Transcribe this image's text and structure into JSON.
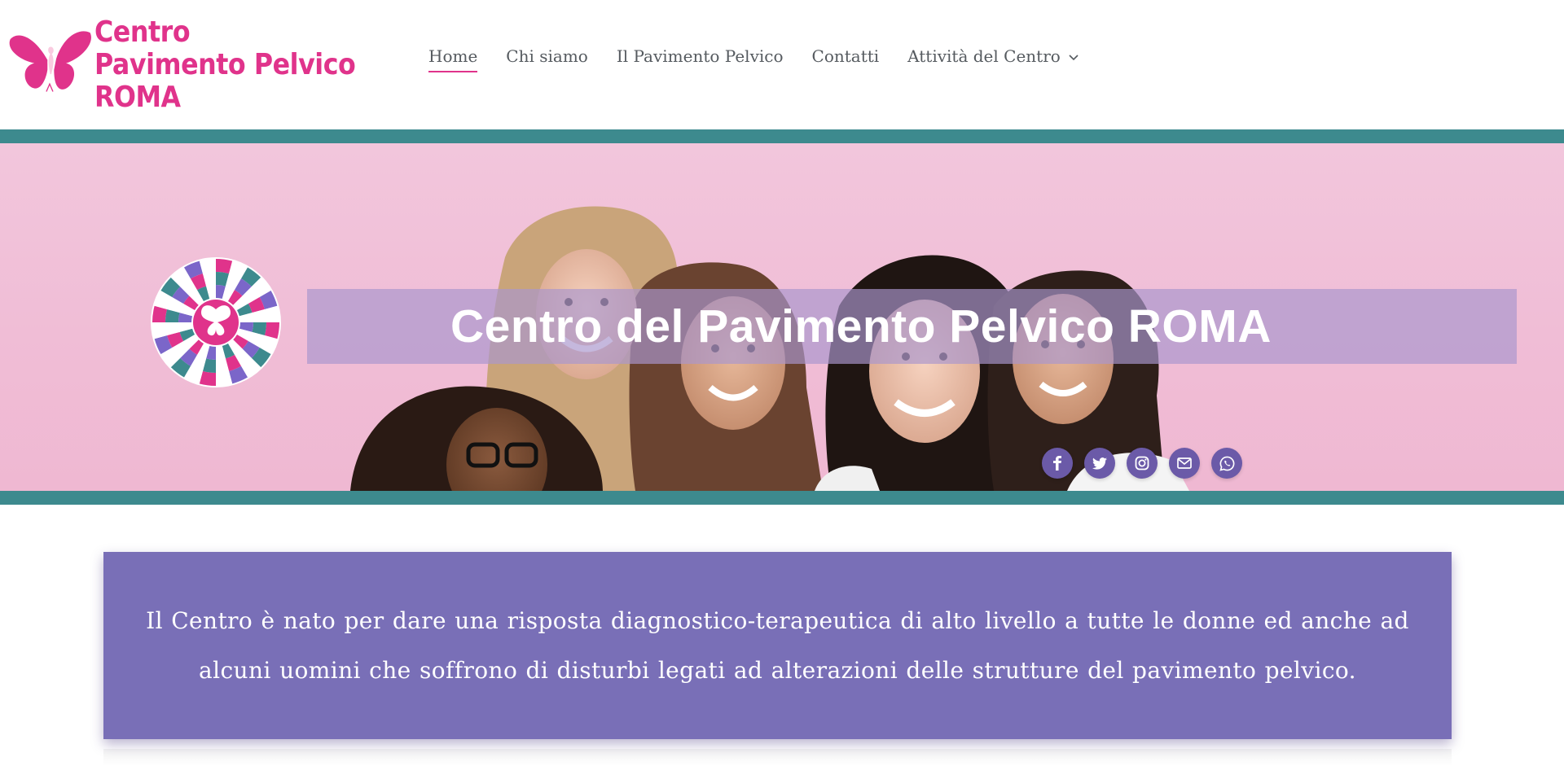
{
  "header": {
    "logo": {
      "line1": "Centro",
      "line2": "Pavimento Pelvico",
      "line3": "ROMA",
      "icon": "butterfly-woman-logo"
    },
    "nav": [
      {
        "label": "Home",
        "active": true
      },
      {
        "label": "Chi siamo",
        "active": false
      },
      {
        "label": "Il Pavimento Pelvico",
        "active": false
      },
      {
        "label": "Contatti",
        "active": false
      },
      {
        "label": "Attività del Centro",
        "active": false,
        "has_dropdown": true
      }
    ]
  },
  "hero": {
    "title": "Centro del Pavimento Pelvico ROMA",
    "badge_icon": "checkered-circle-butterfly-badge",
    "photo": "group-of-smiling-women",
    "social": [
      {
        "name": "facebook-icon"
      },
      {
        "name": "twitter-icon"
      },
      {
        "name": "instagram-icon"
      },
      {
        "name": "email-icon"
      },
      {
        "name": "whatsapp-icon"
      }
    ]
  },
  "intro": {
    "text": "Il Centro è nato per dare una risposta diagnostico-terapeutica di alto livello a tutte le donne ed anche ad alcuni uomini che soffrono di disturbi legati ad alterazioni delle strutture del pavimento pelvico."
  },
  "colors": {
    "brand_pink": "#e0338b",
    "teal": "#3d8a8e",
    "purple": "#796fb7",
    "hero_bg": "#f0bdd6",
    "nav_text": "#555a5f"
  }
}
